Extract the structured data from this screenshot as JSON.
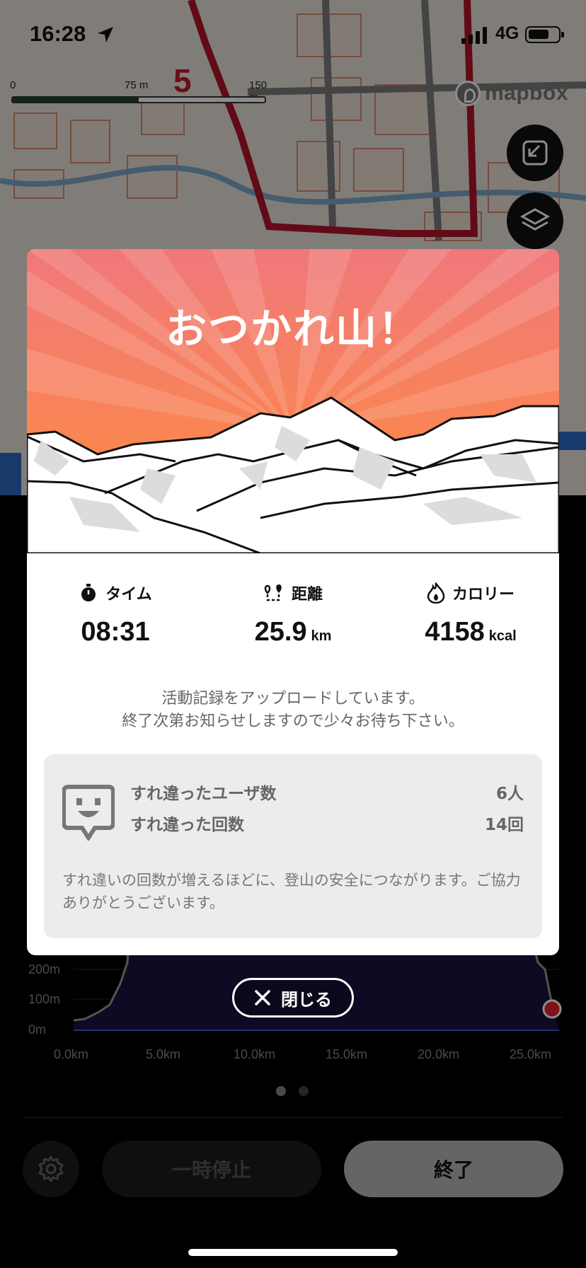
{
  "status_bar": {
    "time": "16:28",
    "network": "4G"
  },
  "map": {
    "scale_labels": [
      "0",
      "75 m",
      "150 m"
    ],
    "route_marker": "5",
    "mapbox_label": "mapbox"
  },
  "modal": {
    "title": "おつかれ山！",
    "stats": [
      {
        "label": "タイム",
        "value": "08:31",
        "unit": "",
        "icon": "stopwatch-icon"
      },
      {
        "label": "距離",
        "value": "25.9",
        "unit": "km",
        "icon": "route-pin-icon"
      },
      {
        "label": "カロリー",
        "value": "4158",
        "unit": "kcal",
        "icon": "flame-icon"
      }
    ],
    "upload_line1": "活動記録をアップロードしています。",
    "upload_line2": "終了次第お知らせしますので少々お待ち下さい。",
    "encounter": {
      "users_label": "すれ違ったユーザ数",
      "users_value": "6人",
      "count_label": "すれ違った回数",
      "count_value": "14回",
      "note": "すれ違いの回数が増えるほどに、登山の安全につながります。ご協力ありがとうございます。"
    }
  },
  "close_button": "閉じる",
  "chart": {
    "y_labels": [
      "200m",
      "100m",
      "0m"
    ],
    "x_labels": [
      "0.0km",
      "5.0km",
      "10.0km",
      "15.0km",
      "20.0km",
      "25.0km"
    ]
  },
  "controls": {
    "pause": "一時停止",
    "end": "終了"
  },
  "colors": {
    "header_top": "#f0787a",
    "header_bottom": "#ff8d3c",
    "chart_fill": "#1a1340",
    "marker": "#e8202c"
  }
}
